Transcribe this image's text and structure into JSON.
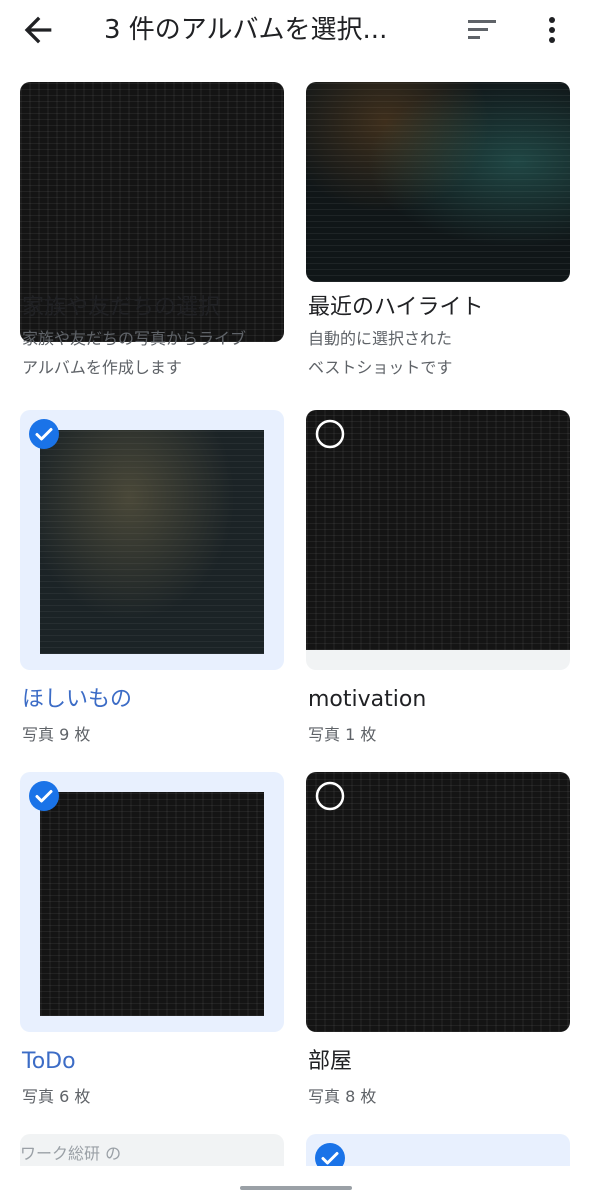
{
  "header": {
    "title": "3 件のアルバムを選択...",
    "back_icon": "arrow-back-icon",
    "sort_icon": "sort-icon",
    "more_icon": "more-vert-icon"
  },
  "colors": {
    "accent": "#1a73e8",
    "selected_bg": "#e8f0fe",
    "selected_title": "#3c6cc6",
    "secondary_text": "#5f6368"
  },
  "albums": [
    {
      "title": "家族や友だちの選択",
      "subtitle": "家族や友だちの写真からライブアルバムを作成します",
      "selected": null
    },
    {
      "title": "最近のハイライト",
      "subtitle": "自動的に選択された\nベストショットです",
      "selected": null
    },
    {
      "title": "ほしいもの",
      "subtitle": "写真 9 枚",
      "selected": true
    },
    {
      "title": "motivation",
      "subtitle": "写真 1 枚",
      "selected": false
    },
    {
      "title": "ToDo",
      "subtitle": "写真 6 枚",
      "selected": true
    },
    {
      "title": "部屋",
      "subtitle": "写真 8 枚",
      "selected": false
    }
  ],
  "partial_cards": [
    {
      "text": "ワーク総研 の",
      "selected": false
    },
    {
      "text": "",
      "selected": true
    }
  ]
}
